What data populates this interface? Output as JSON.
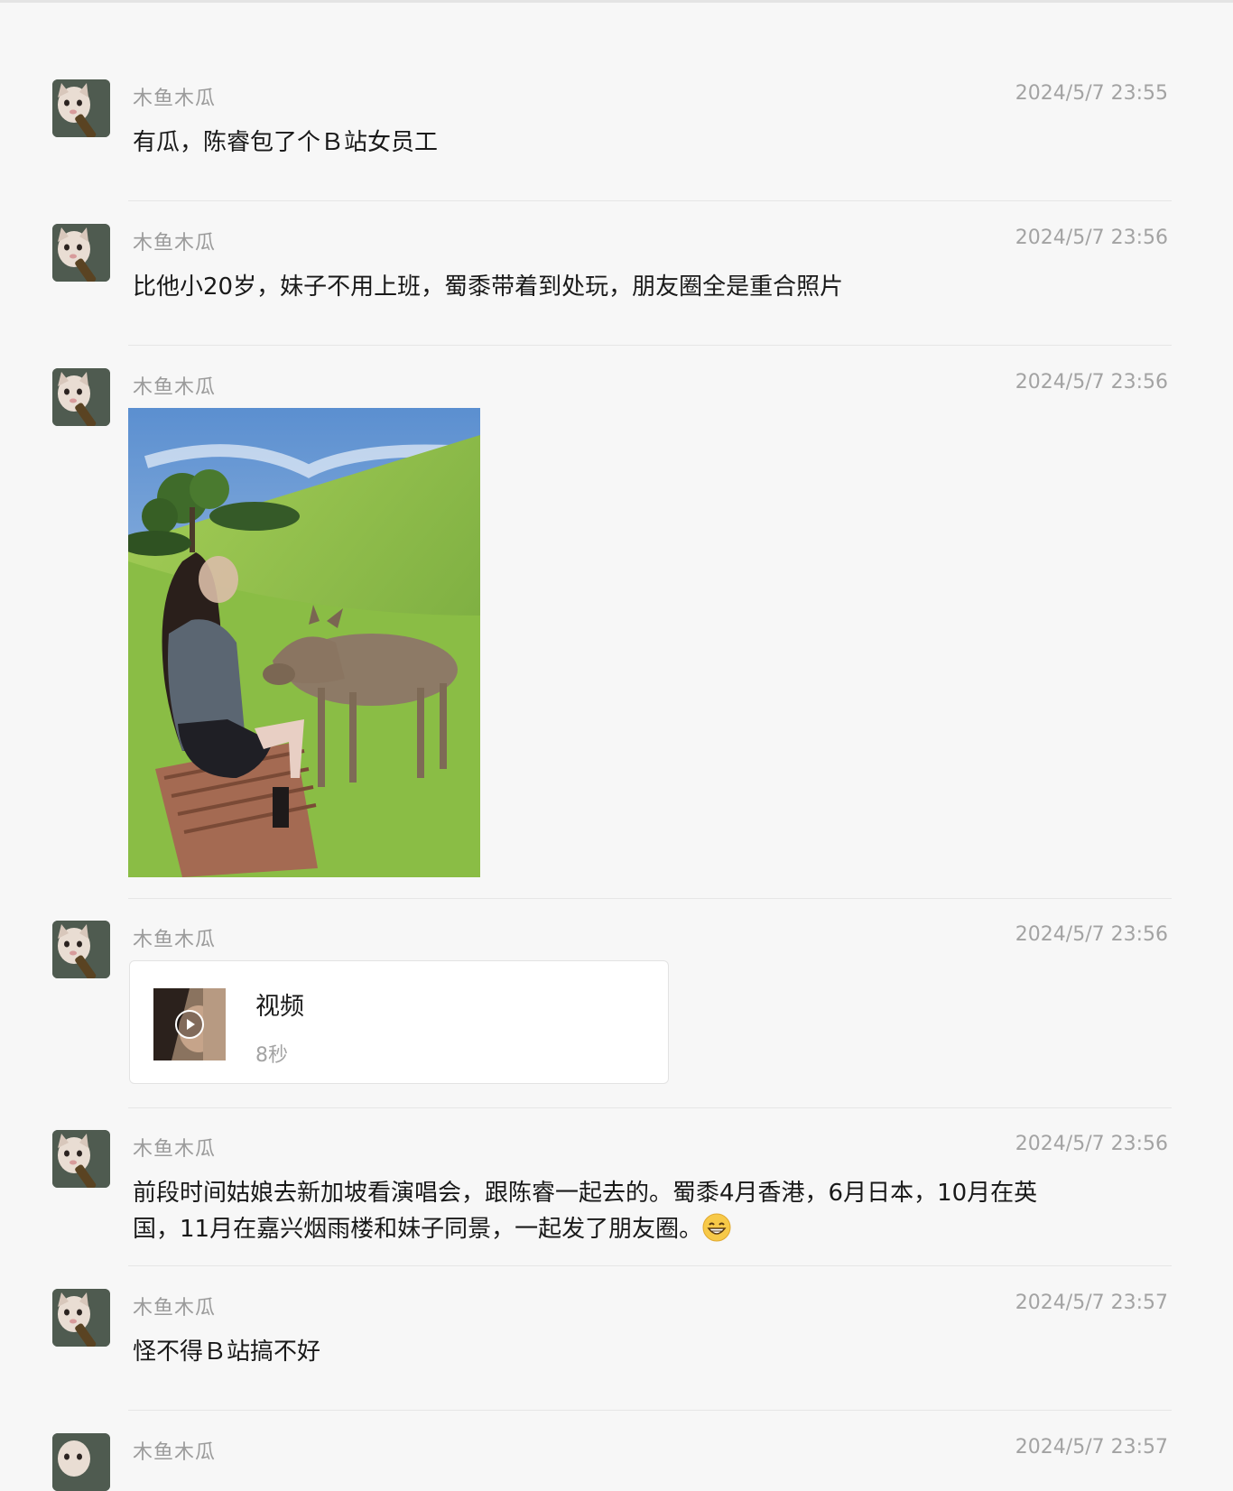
{
  "messages": [
    {
      "sender": "木鱼木瓜",
      "time": "2024/5/7 23:55",
      "text": "有瓜，陈睿包了个Ｂ站女员工"
    },
    {
      "sender": "木鱼木瓜",
      "time": "2024/5/7 23:56",
      "text": "比他小20岁，妹子不用上班，蜀黍带着到处玩，朋友圈全是重合照片"
    },
    {
      "sender": "木鱼木瓜",
      "time": "2024/5/7 23:56",
      "image": "photo-girl-feeding-deer-on-grass"
    },
    {
      "sender": "木鱼木瓜",
      "time": "2024/5/7 23:56",
      "video": {
        "title": "视频",
        "duration": "8秒"
      }
    },
    {
      "sender": "木鱼木瓜",
      "time": "2024/5/7 23:56",
      "text_line1": "前段时间姑娘去新加坡看演唱会，跟陈睿一起去的。蜀黍4月香港，6月日本，10月在英",
      "text_line2": "国，11月在嘉兴烟雨楼和妹子同景，一起发了朋友圈。",
      "emoji": "grinning-face-icon"
    },
    {
      "sender": "木鱼木瓜",
      "time": "2024/5/7 23:57",
      "text": "怪不得Ｂ站搞不好"
    },
    {
      "sender": "木鱼木瓜",
      "time": "2024/5/7 23:57"
    }
  ],
  "colors": {
    "background": "#f7f7f7",
    "sender": "#9b9b9b",
    "timestamp": "#a3a3a3",
    "text": "#191919"
  }
}
